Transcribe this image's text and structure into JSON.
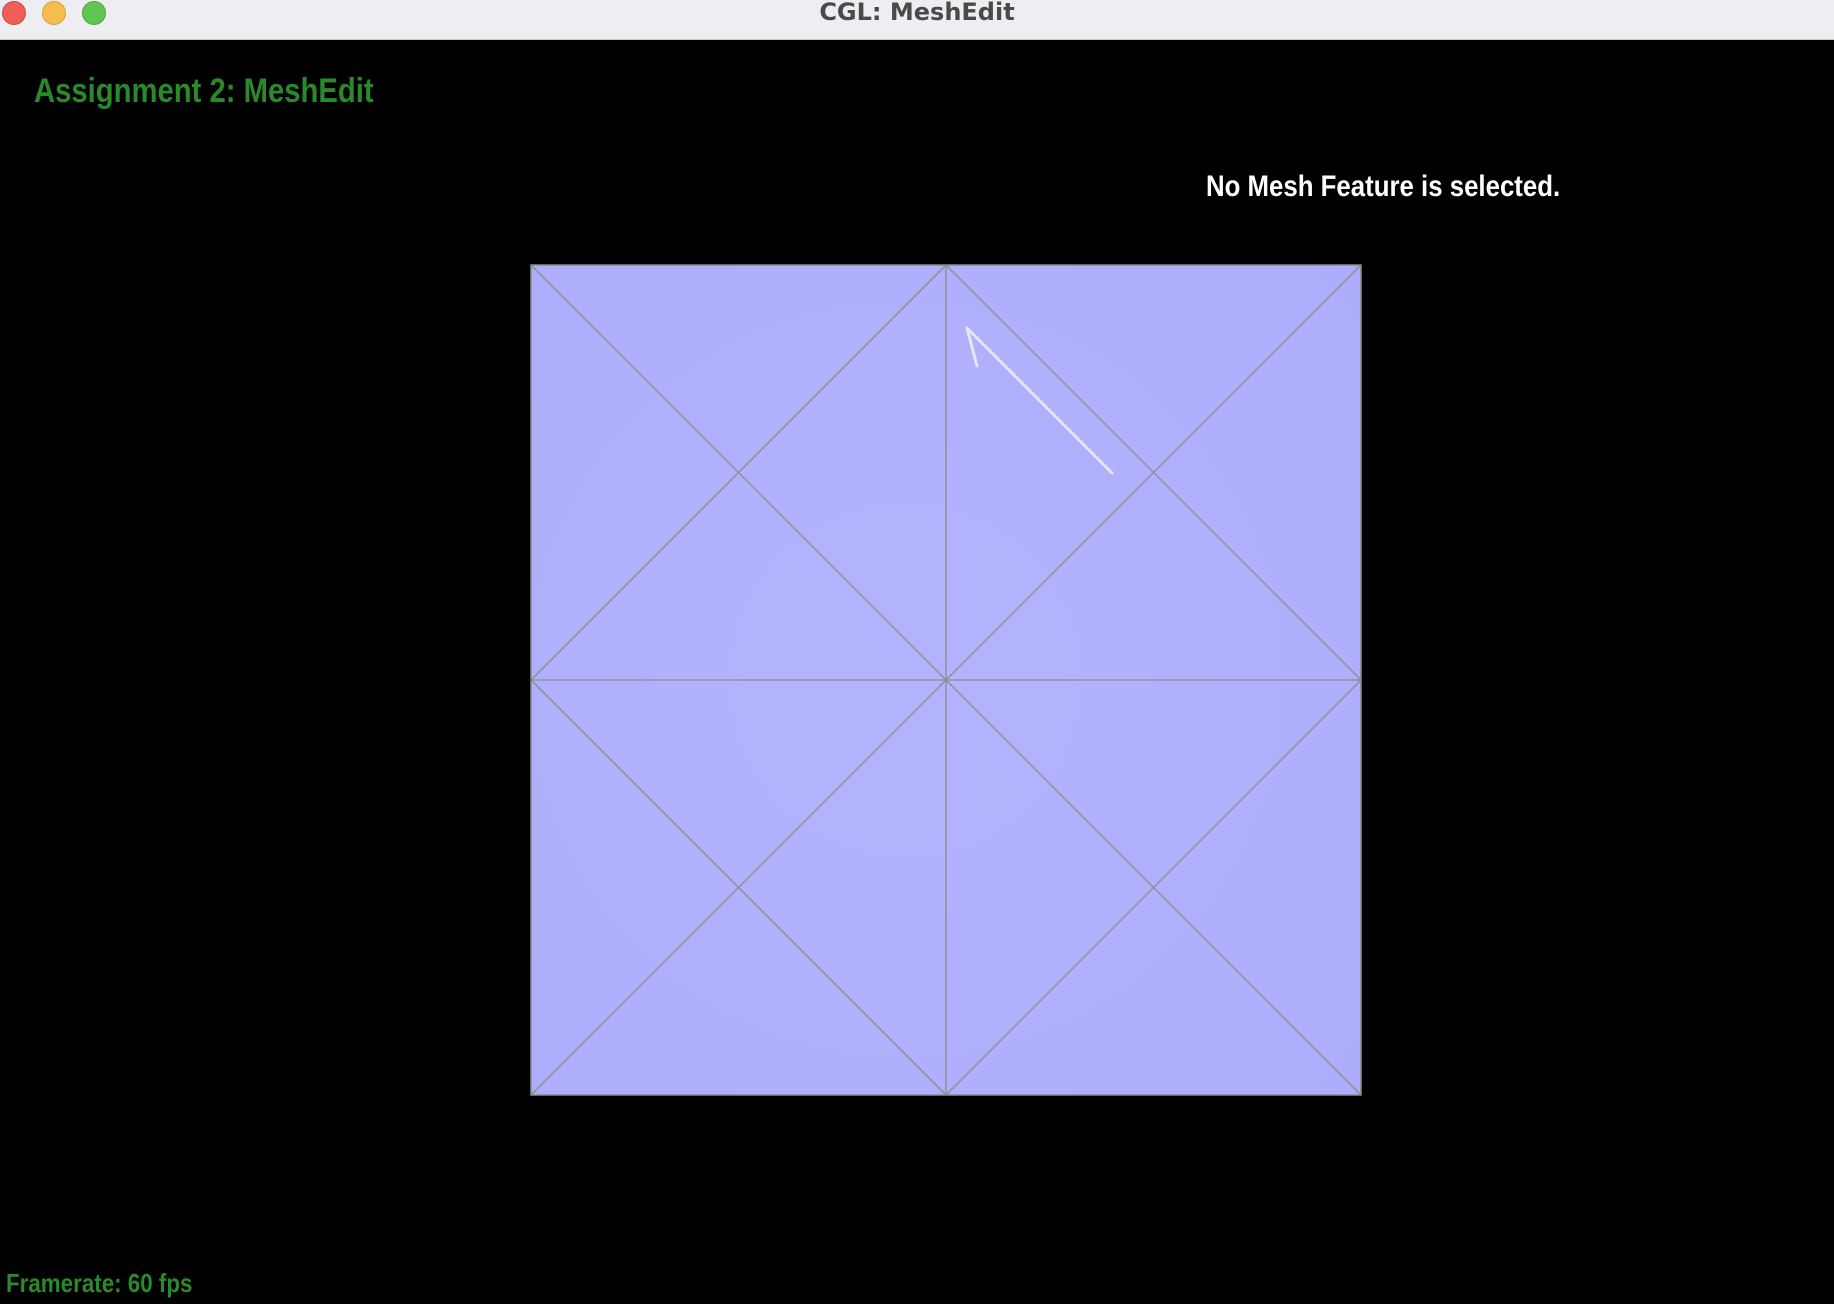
{
  "window": {
    "title": "CGL: MeshEdit",
    "buttons": [
      "close",
      "minimize",
      "maximize"
    ]
  },
  "overlay": {
    "heading": "Assignment 2: MeshEdit",
    "selection_status": "No Mesh Feature is selected.",
    "framerate": "Framerate: 60 fps"
  },
  "colors": {
    "background": "#000000",
    "mesh_fill": "#b0b0fd",
    "mesh_edge": "#8a8a8a",
    "halfedge": "#e6e6ec",
    "overlay_green": "#2a8a2a",
    "overlay_white": "#ffffff"
  },
  "mesh": {
    "faces": 16,
    "vertices": 13,
    "selection": "none"
  }
}
